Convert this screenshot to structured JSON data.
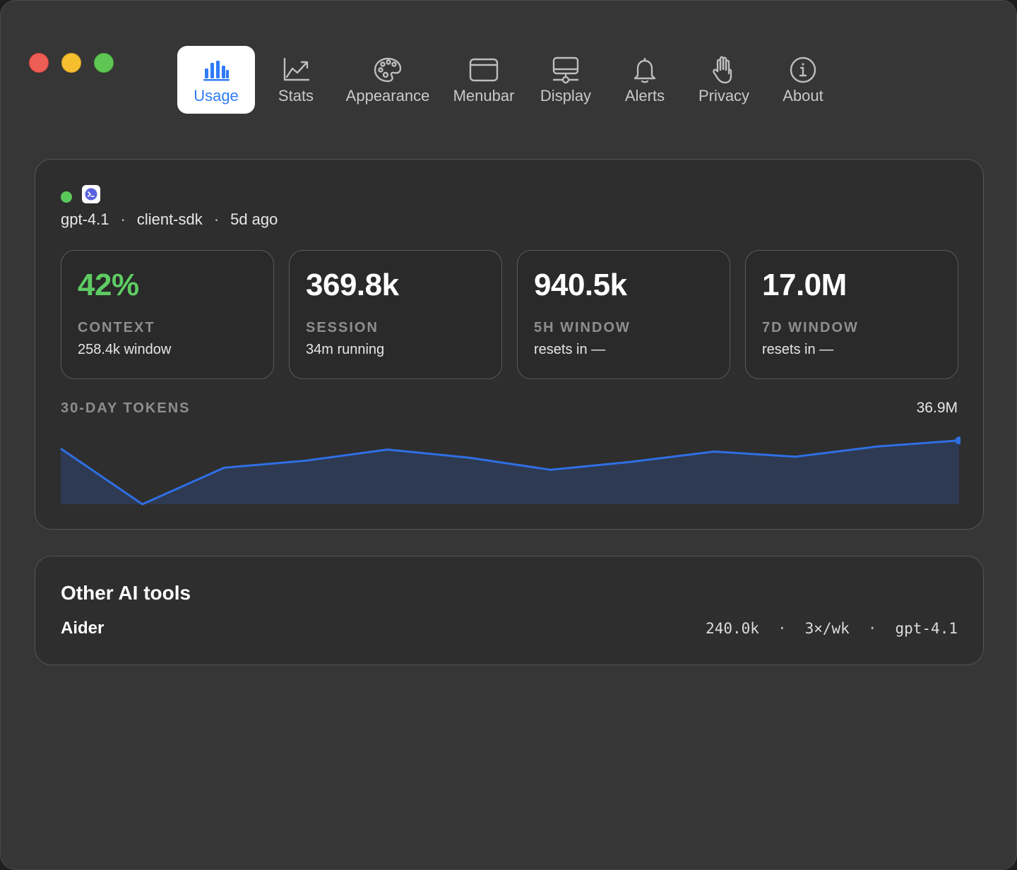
{
  "toolbar": {
    "tabs": [
      {
        "label": "Usage",
        "icon": "bar-chart-icon",
        "active": true
      },
      {
        "label": "Stats",
        "icon": "trend-chart-icon"
      },
      {
        "label": "Appearance",
        "icon": "palette-icon"
      },
      {
        "label": "Menubar",
        "icon": "window-icon"
      },
      {
        "label": "Display",
        "icon": "display-icon"
      },
      {
        "label": "Alerts",
        "icon": "bell-icon"
      },
      {
        "label": "Privacy",
        "icon": "hand-icon"
      },
      {
        "label": "About",
        "icon": "info-icon"
      }
    ]
  },
  "session": {
    "model": "gpt-4.1",
    "client": "client-sdk",
    "last_seen": "5d ago",
    "separator": "·",
    "status_color": "#5bc95a"
  },
  "stats": [
    {
      "value": "42%",
      "label": "CONTEXT",
      "sub": "258.4k window",
      "color": "#5ecc62"
    },
    {
      "value": "369.8k",
      "label": "SESSION",
      "sub": "34m running"
    },
    {
      "value": "940.5k",
      "label": "5H WINDOW",
      "sub": "resets in —"
    },
    {
      "value": "17.0M",
      "label": "7D WINDOW",
      "sub": "resets in —"
    }
  ],
  "chart": {
    "title": "30-DAY TOKENS",
    "max_label": "36.9M"
  },
  "chart_data": {
    "type": "area",
    "title": "30-DAY TOKENS",
    "series": [
      {
        "values": [
          30.0,
          24.5,
          28.1,
          28.8,
          29.9,
          29.1,
          27.9,
          28.7,
          29.7,
          29.2,
          30.2,
          30.8
        ]
      }
    ],
    "ylim": [
      24.5,
      36.9
    ],
    "max_label": "36.9M",
    "line_color": "#2f6fe4",
    "fill_color": "#2e3a52",
    "grid": false
  },
  "other_tools": {
    "title": "Other AI tools",
    "items": [
      {
        "name": "Aider",
        "tokens": "240.0k",
        "frequency": "3×/wk",
        "model": "gpt-4.1",
        "separator": "·"
      }
    ]
  },
  "colors": {
    "accent": "#2f7bf6",
    "background": "#363636",
    "card": "#2e2e2e"
  }
}
